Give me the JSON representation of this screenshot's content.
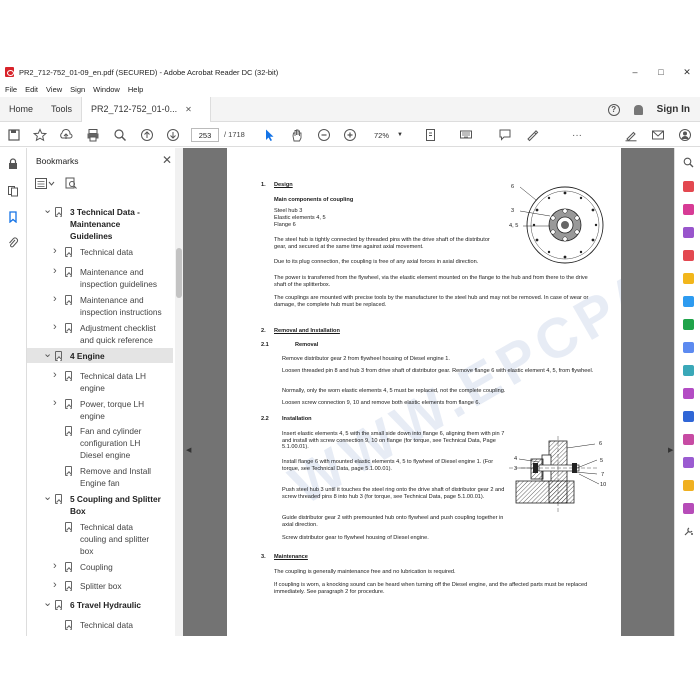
{
  "window": {
    "title": "PR2_712-752_01-09_en.pdf (SECURED) - Adobe Acrobat Reader DC (32-bit)",
    "controls": {
      "minimize": "–",
      "maximize": "□",
      "close": "✕"
    }
  },
  "menu": [
    "File",
    "Edit",
    "View",
    "Sign",
    "Window",
    "Help"
  ],
  "tabs": {
    "home": "Home",
    "tools": "Tools",
    "doc": "PR2_712-752_01-0...",
    "close": "✕",
    "signin": "Sign In",
    "help": "?"
  },
  "toolbar": {
    "page_current": "253",
    "page_total": "/ 1718",
    "zoom": "72%",
    "more": "···"
  },
  "bookmarks": {
    "header": "Bookmarks",
    "close": "✕",
    "items": [
      {
        "label": "3 Technical Data -",
        "bold": true
      },
      {
        "label": "Maintenance",
        "bold": true
      },
      {
        "label": "Guidelines",
        "bold": true
      },
      {
        "label": "Technical data"
      },
      {
        "label": "Maintenance and"
      },
      {
        "label": "inspection guidelines"
      },
      {
        "label": "Maintenance and"
      },
      {
        "label": "inspection instructions"
      },
      {
        "label": "Adjustment checklist"
      },
      {
        "label": "and quick reference"
      },
      {
        "label": "4 Engine",
        "bold": true
      },
      {
        "label": "Technical data LH"
      },
      {
        "label": "engine"
      },
      {
        "label": "Power, torque LH"
      },
      {
        "label": "engine"
      },
      {
        "label": "Fan and cylinder"
      },
      {
        "label": "configuration LH"
      },
      {
        "label": "Diesel engine"
      },
      {
        "label": "Remove and Install"
      },
      {
        "label": "Engine fan"
      },
      {
        "label": "5 Coupling and Splitter",
        "bold": true
      },
      {
        "label": "Box",
        "bold": true
      },
      {
        "label": "Technical data"
      },
      {
        "label": "couling and splitter"
      },
      {
        "label": "box"
      },
      {
        "label": "Coupling"
      },
      {
        "label": "Splitter box"
      },
      {
        "label": "6 Travel Hydraulic",
        "bold": true
      },
      {
        "label": "Technical data"
      }
    ]
  },
  "doc": {
    "s1_num": "1.",
    "s1_title": "Design",
    "s1_sub": "Main components of coupling",
    "s1_parts": [
      "Steel hub    3",
      "Elastic elements    4, 5",
      "Flange  6"
    ],
    "s1_p1": "The steel hub is tightly connected by threaded pins with the drive shaft of the distributor gear,  and secured at the same time against axial movement.",
    "s1_p2": "Due to its plug connection, the coupling is free of any axial forces in axial direction.",
    "s1_p3": "The power  is transferred from  the flywheel, via the elastic element mounted on the flange to the hub and from there to the drive shaft of the splitterbox.",
    "s1_p4": "The couplings are mounted with precise tools by the manufacturer to the steel hub and may not be removed.  In case of wear or damage, the complete hub must be replaced.",
    "s2_num": "2.",
    "s2_title": "Removal and Installation",
    "s21_num": "2.1",
    "s21_title": "Removal",
    "s21_p1": "Remove distributor gear 2 from flywheel housing of Diesel engine 1.",
    "s21_p2": "Loosen threaded pin 8 and hub 3 from drive shaft of distributor gear.  Remove flange 6 with elastic element 4, 5, from flywheel.",
    "s21_p3": "Normally, only the worn elastic elements 4, 5 must be replaced, not the complete coupling.",
    "s21_p4": "Loosen screw connection 9, 10 and remove both elastic elements from flange  6.",
    "s22_num": "2.2",
    "s22_title": "Installation",
    "s22_p1": "Insert elastic elements 4, 5 with the small side down into flange 6, aligning them with pin 7 and install with screw connection 9, 10 on flange (for torque,  see Technical Data, Page 5.1.00.01).",
    "s22_p2": "Install flange 6 with mounted elastic elements  4, 5 to flywheel of Diesel engine   1.  (For torque, see Technical Data, page 5.1.00.01).",
    "s22_p3": "Push steel hub  3 until it touches the steel ring onto the drive shaft of distributor gear 2 and screw threaded pins 8 into hub  3 (for torque, see Technical Data, page  5.1.00.01).",
    "s22_p4": "Guide distributor gear 2 with premounted hub onto flywheel and push coupling together in axial direction.",
    "s22_p5": "Screw distributor gear to flywheel housing of Diesel engine.",
    "s3_num": "3.",
    "s3_title": "Maintenance",
    "s3_p1": "The coupling is generally maintenance free and no lubrication is required.",
    "s3_p2": "If coupling is worn, a knocking sound can be heard when turning off the Diesel engine, and the affected parts must be replaced immediately.  See paragraph 2 for procedure.",
    "fig1_labels": {
      "a": "6",
      "b": "3",
      "c": "4, 5"
    },
    "fig2_labels": {
      "a": "6",
      "b": "4",
      "c": "5",
      "d": "3",
      "e": "7",
      "f": "10"
    },
    "watermark": "WWW.EPCPARTS.COM"
  },
  "colors": {
    "accent": "#1473e6",
    "doc_bg": "#737373",
    "tool_red": "#d8232a"
  }
}
